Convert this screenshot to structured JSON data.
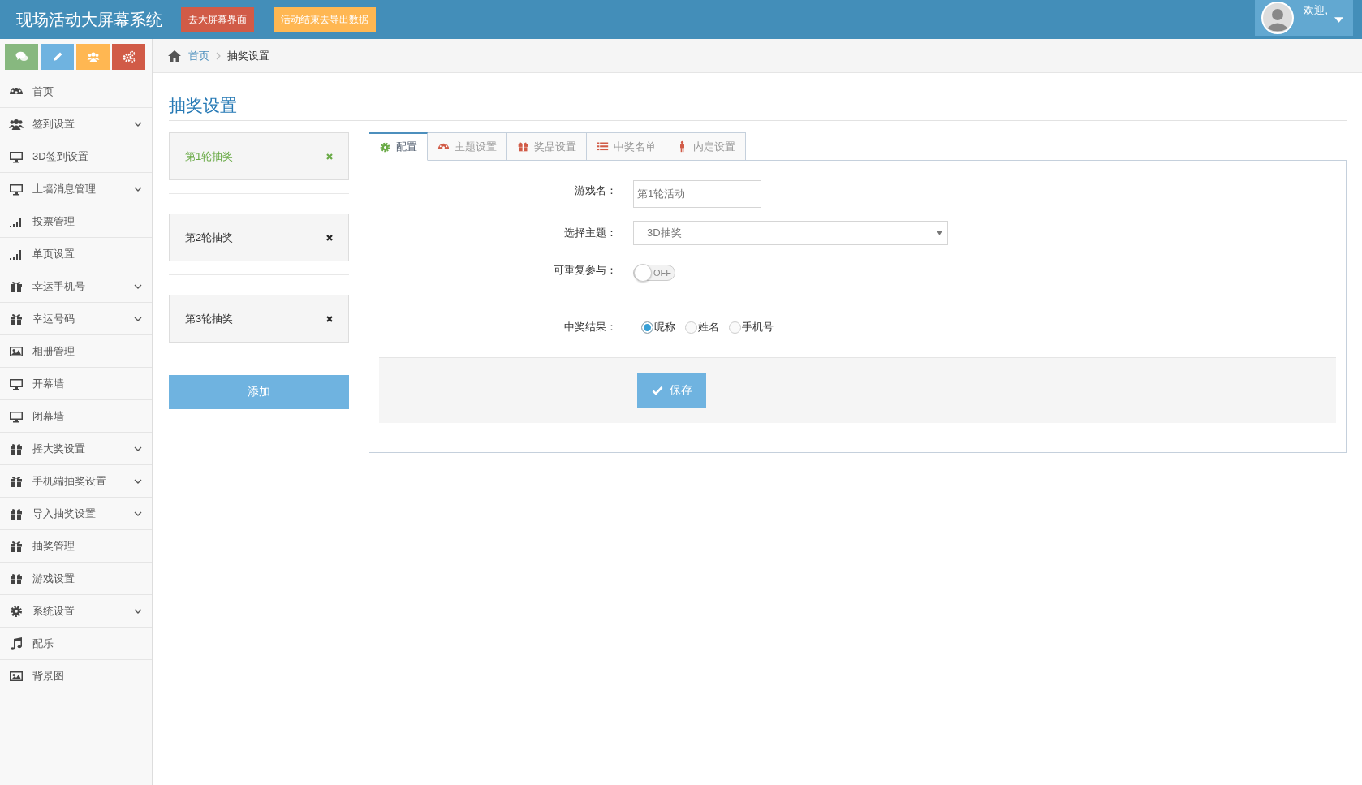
{
  "header": {
    "title": "现场活动大屏幕系统",
    "buttons": [
      {
        "label": "去大屏幕界面",
        "kind": "danger"
      },
      {
        "label": "活动结束去导出数据",
        "kind": "warning"
      }
    ],
    "user": {
      "greeting": "欢迎,"
    }
  },
  "shortcuts": [
    {
      "kind": "comments",
      "color": "#87b87f"
    },
    {
      "kind": "pencil",
      "color": "#6fb3e0"
    },
    {
      "kind": "users",
      "color": "#ffb752"
    },
    {
      "kind": "cogs",
      "color": "#d15b47"
    }
  ],
  "sidebar": {
    "items": [
      {
        "label": "首页",
        "kind": "dashboard",
        "has_submenu": false
      },
      {
        "label": "签到设置",
        "kind": "users",
        "has_submenu": true
      },
      {
        "label": "3D签到设置",
        "kind": "monitor",
        "has_submenu": false
      },
      {
        "label": "上墙消息管理",
        "kind": "monitor",
        "has_submenu": true
      },
      {
        "label": "投票管理",
        "kind": "signal",
        "has_submenu": false
      },
      {
        "label": "单页设置",
        "kind": "signal",
        "has_submenu": false
      },
      {
        "label": "幸运手机号",
        "kind": "gift",
        "has_submenu": true
      },
      {
        "label": "幸运号码",
        "kind": "gift",
        "has_submenu": true
      },
      {
        "label": "相册管理",
        "kind": "image",
        "has_submenu": false
      },
      {
        "label": "开幕墙",
        "kind": "monitor",
        "has_submenu": false
      },
      {
        "label": "闭幕墙",
        "kind": "monitor",
        "has_submenu": false
      },
      {
        "label": "摇大奖设置",
        "kind": "gift",
        "has_submenu": true
      },
      {
        "label": "手机端抽奖设置",
        "kind": "gift",
        "has_submenu": true
      },
      {
        "label": "导入抽奖设置",
        "kind": "gift",
        "has_submenu": true
      },
      {
        "label": "抽奖管理",
        "kind": "gift",
        "has_submenu": false
      },
      {
        "label": "游戏设置",
        "kind": "gift",
        "has_submenu": false
      },
      {
        "label": "系统设置",
        "kind": "gear",
        "has_submenu": true
      },
      {
        "label": "配乐",
        "kind": "music",
        "has_submenu": false
      },
      {
        "label": "背景图",
        "kind": "image",
        "has_submenu": false
      }
    ]
  },
  "breadcrumb": [
    {
      "label": "首页",
      "link": true
    },
    {
      "label": "抽奖设置",
      "link": false
    }
  ],
  "page_title": "抽奖设置",
  "rounds": [
    {
      "label": "第1轮抽奖",
      "selected": true
    },
    {
      "label": "第2轮抽奖",
      "selected": false
    },
    {
      "label": "第3轮抽奖",
      "selected": false
    }
  ],
  "add_button": "添加",
  "tabs": [
    {
      "label": "配置",
      "kind": "gear",
      "selected": true
    },
    {
      "label": "主题设置",
      "kind": "dashboard",
      "selected": false
    },
    {
      "label": "奖品设置",
      "kind": "gift",
      "selected": false
    },
    {
      "label": "中奖名单",
      "kind": "list",
      "selected": false
    },
    {
      "label": "内定设置",
      "kind": "person",
      "selected": false
    }
  ],
  "form": {
    "game_name": {
      "label": "游戏名：",
      "value": "第1轮活动"
    },
    "theme": {
      "label": "选择主题：",
      "value": "3D抽奖"
    },
    "repeat": {
      "label": "可重复参与：",
      "on": false,
      "state_text": "OFF"
    },
    "result": {
      "label": "中奖结果：",
      "options": [
        {
          "label": "昵称",
          "selected": true
        },
        {
          "label": "姓名",
          "selected": false
        },
        {
          "label": "手机号",
          "selected": false
        }
      ]
    }
  },
  "save_button": "保存"
}
